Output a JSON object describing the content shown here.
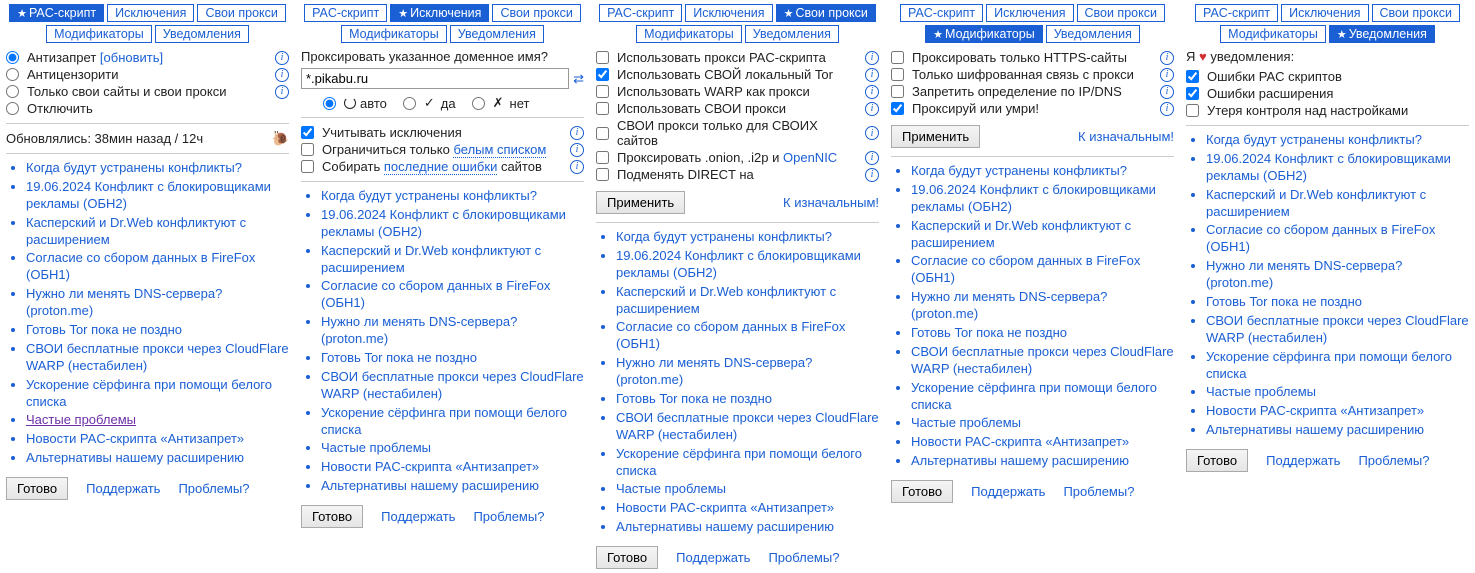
{
  "tabs": {
    "pac": "PAC-скрипт",
    "exceptions": "Исключения",
    "own": "Свои прокси",
    "mods": "Модификаторы",
    "notif": "Уведомления"
  },
  "col1": {
    "opt_antizapret": "Антизапрет",
    "update": "[обновить]",
    "opt_anticensority": "Антицензорити",
    "opt_ownsites": "Только свои сайты и свои прокси",
    "opt_off": "Отключить",
    "status": "Обновлялись: 38мин назад / 12ч"
  },
  "col2": {
    "prompt": "Проксировать указанное доменное имя?",
    "host": "*.pikabu.ru",
    "r_auto": "авто",
    "r_yes": "да",
    "r_no": "нет",
    "c_exceptions": "Учитывать исключения",
    "c_whitelist_pre": "Ограничиться только ",
    "c_whitelist_link": "белым списком",
    "c_errors_pre": "Собирать ",
    "c_errors_link": "последние ошибки",
    "c_errors_post": " сайтов"
  },
  "col3": {
    "c1": "Использовать прокси PAC-скрипта",
    "c2": "Использовать СВОЙ локальный Tor",
    "c3": "Использовать WARP как прокси",
    "c4": "Использовать СВОИ прокси",
    "c5": "СВОИ прокси только для СВОИХ сайтов",
    "c6a": "Проксировать .onion, .i2p и ",
    "c6b": "OpenNIC",
    "c7": "Подменять DIRECT на"
  },
  "col4": {
    "c1": "Проксировать только HTTPS-сайты",
    "c2": "Только шифрованная связь с прокси",
    "c3": "Запретить определение по IP/DNS",
    "c4": "Проксируй или умри!"
  },
  "col5": {
    "intro_a": "Я ",
    "intro_b": " уведомления:",
    "c1": "Ошибки PAC скриптов",
    "c2": "Ошибки расширения",
    "c3": "Утеря контроля над настройками"
  },
  "apply": "Применить",
  "reset": "К изначальным!",
  "faq": [
    "Когда будут устранены конфликты?",
    "19.06.2024 Конфликт с блокировщиками рекламы (ОБН2)",
    "Касперский и Dr.Web конфликтуют с расширением",
    "Согласие со сбором данных в FireFox (ОБН1)",
    "Нужно ли менять DNS-сервера? (proton.me)",
    "Готовь Tor пока не поздно",
    "СВОИ бесплатные прокси через CloudFlare WARP (нестабилен)",
    "Ускорение сёрфинга при помощи белого списка",
    "Частые проблемы",
    "Новости PAC-скрипта «Антизапрет»",
    "Альтернативы нашему расширению"
  ],
  "ready": "Готово",
  "support": "Поддержать",
  "problems": "Проблемы?",
  "check_glyph": "✓",
  "cross_glyph": "✗"
}
